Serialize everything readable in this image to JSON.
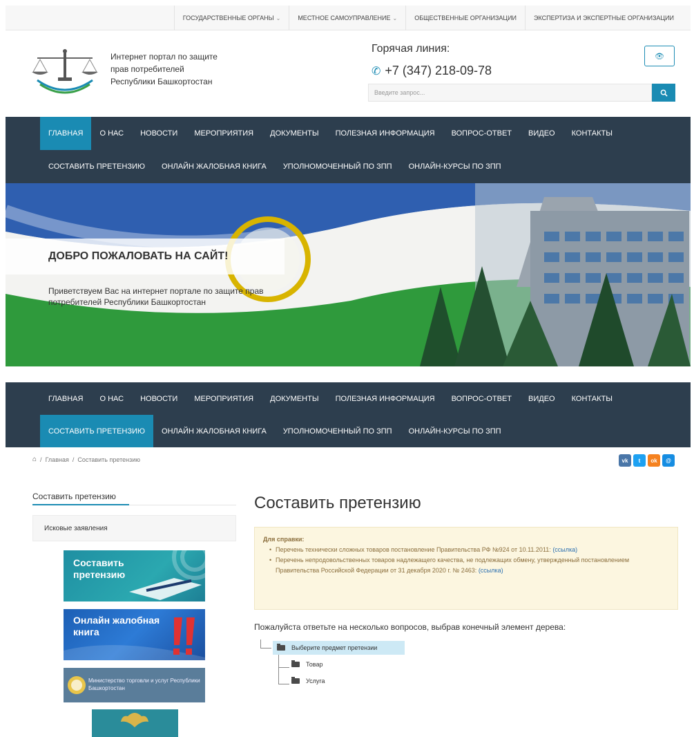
{
  "topbar": {
    "items": [
      "ГОСУДАРСТВЕННЫЕ ОРГАНЫ",
      "МЕСТНОЕ САМОУПРАВЛЕНИЕ",
      "ОБЩЕСТВЕННЫЕ ОРГАНИЗАЦИИ",
      "ЭКСПЕРТИЗА И ЭКСПЕРТНЫЕ ОРГАНИЗАЦИИ"
    ]
  },
  "header": {
    "logo_line1": "Интернет портал по защите",
    "logo_line2": "прав потребителей",
    "logo_line3": "Республики Башкортостан",
    "hotline_label": "Горячая линия:",
    "hotline_phone": "+7 (347) 218-09-78",
    "search_placeholder": "Введите запрос..."
  },
  "nav": {
    "row1": [
      "ГЛАВНАЯ",
      "О НАС",
      "НОВОСТИ",
      "МЕРОПРИЯТИЯ",
      "ДОКУМЕНТЫ",
      "ПОЛЕЗНАЯ ИНФОРМАЦИЯ",
      "ВОПРОС-ОТВЕТ",
      "ВИДЕО",
      "КОНТАКТЫ"
    ],
    "row2": [
      "СОСТАВИТЬ ПРЕТЕНЗИЮ",
      "ОНЛАЙН ЖАЛОБНАЯ КНИГА",
      "УПОЛНОМОЧЕННЫЙ ПО ЗПП",
      "ОНЛАЙН-КУРСЫ ПО ЗПП"
    ]
  },
  "hero": {
    "welcome": "ДОБРО ПОЖАЛОВАТЬ НА САЙТ!",
    "subtitle": "Приветствуем Вас на интернет портале по защите прав потребителей Республики Башкортостан"
  },
  "breadcrumb": {
    "home": "Главная",
    "current": "Составить претензию"
  },
  "social": [
    "vk",
    "tw",
    "ok",
    "mr"
  ],
  "sidebar": {
    "title": "Составить претензию",
    "item": "Исковые заявления",
    "banner1": "Составить претензию",
    "banner2": "Онлайн жалобная книга",
    "banner3": "Министерство торговли и услуг Республики Башкортостан"
  },
  "main": {
    "title": "Составить претензию",
    "note_heading": "Для справки:",
    "note_item1": "Перечень технически сложных товаров постановление Правительства РФ №924 от 10.11.2011:",
    "note_item1_link": "(ссылка)",
    "note_item2": "Перечень непродовольственных товаров надлежащего качества, не подлежащих обмену, утвержденный постановлением Правительства Российской Федерации от 31 декабря 2020 г. № 2463:",
    "note_item2_link": "(ссылка)",
    "question": "Пожалуйста ответьте на несколько вопросов, выбрав конечный элемент дерева:",
    "tree_root": "Выберите предмет претензии",
    "tree_leaf1": "Товар",
    "tree_leaf2": "Услуга"
  },
  "colors": {
    "accent": "#1a8bb3",
    "nav_bg": "#2d3e4e",
    "note_bg": "#fcf6e0"
  }
}
